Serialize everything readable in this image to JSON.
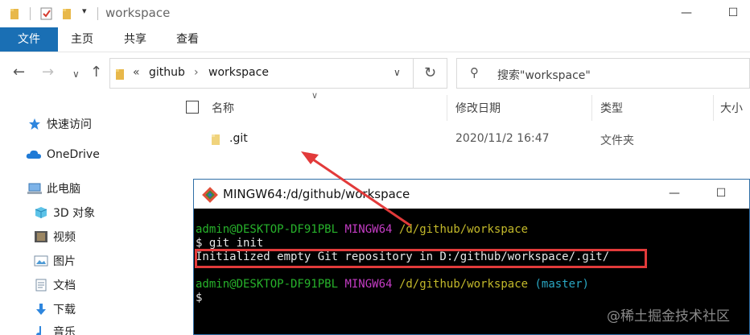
{
  "window": {
    "title": "workspace",
    "minimize_glyph": "—",
    "maximize_glyph": "☐"
  },
  "ribbon": {
    "tabs": [
      "文件",
      "主页",
      "共享",
      "查看"
    ]
  },
  "address": {
    "overflow": "«",
    "crumbs": [
      "github",
      "workspace"
    ],
    "separator": "›"
  },
  "search": {
    "placeholder": "搜索\"workspace\""
  },
  "nav_pane": {
    "items": [
      {
        "label": "快速访问",
        "icon": "star-icon"
      },
      {
        "label": "OneDrive",
        "icon": "cloud-icon"
      },
      {
        "label": "此电脑",
        "icon": "computer-icon"
      },
      {
        "label": "3D 对象",
        "icon": "cube-icon"
      },
      {
        "label": "视频",
        "icon": "video-icon"
      },
      {
        "label": "图片",
        "icon": "picture-icon"
      },
      {
        "label": "文档",
        "icon": "document-icon"
      },
      {
        "label": "下载",
        "icon": "download-icon"
      },
      {
        "label": "音乐",
        "icon": "music-icon"
      }
    ]
  },
  "file_list": {
    "columns": [
      "名称",
      "修改日期",
      "类型",
      "大小"
    ],
    "rows": [
      {
        "name": ".git",
        "modified": "2020/11/2 16:47",
        "type": "文件夹"
      }
    ]
  },
  "terminal": {
    "title": "MINGW64:/d/github/workspace",
    "minimize_glyph": "—",
    "maximize_glyph": "☐",
    "line1": {
      "user": "admin@DESKTOP-DF91PBL",
      "shell": "MINGW64",
      "path": "/d/github/workspace"
    },
    "line2": "$ git init",
    "line3": "Initialized empty Git repository in D:/github/workspace/.git/",
    "line5": {
      "user": "admin@DESKTOP-DF91PBL",
      "shell": "MINGW64",
      "path": "/d/github/workspace",
      "branch": "(master)"
    },
    "line6": "$"
  },
  "watermark": "@稀土掘金技术社区",
  "colors": {
    "accent": "#1a6fb4",
    "highlight": "#e23a3a",
    "prompt_green": "#27b22b",
    "prompt_magenta": "#c43cc4",
    "prompt_yellow": "#c3b92a",
    "branch_cyan": "#2aa7c3"
  }
}
